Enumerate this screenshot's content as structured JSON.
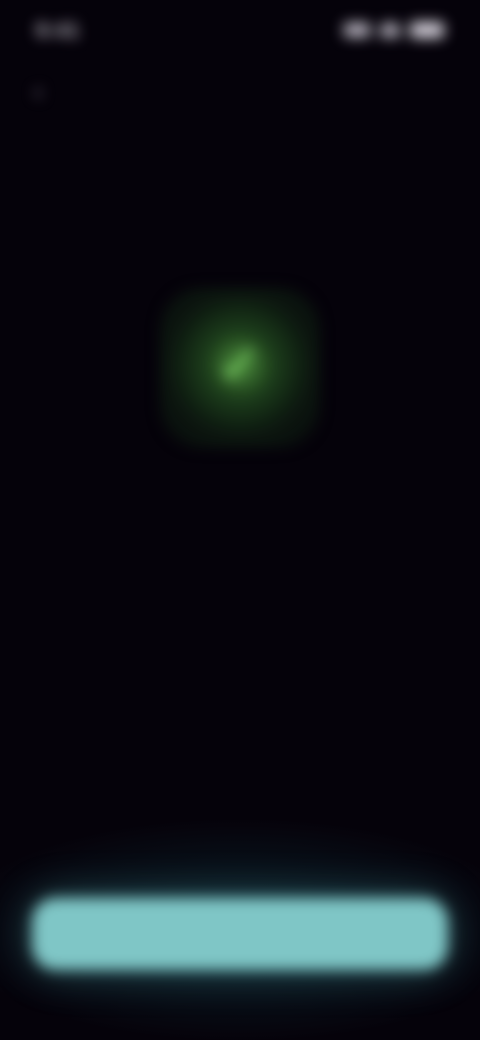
{
  "status_bar": {
    "time": "9:41",
    "icons": [
      "signal-icon",
      "wifi-icon",
      "battery-icon"
    ]
  },
  "nav": {
    "back_icon": "chevron-left-icon",
    "title": ""
  },
  "feature": {
    "icon": "check-icon",
    "icon_glyph": "✓",
    "accent_color": "#5aa646"
  },
  "title": "",
  "description": "",
  "primary_button": {
    "label": "",
    "color": "#7fc6c6"
  },
  "colors": {
    "background": "#05020a",
    "accent": "#7fc6c6",
    "feature_green": "#5aa646"
  }
}
